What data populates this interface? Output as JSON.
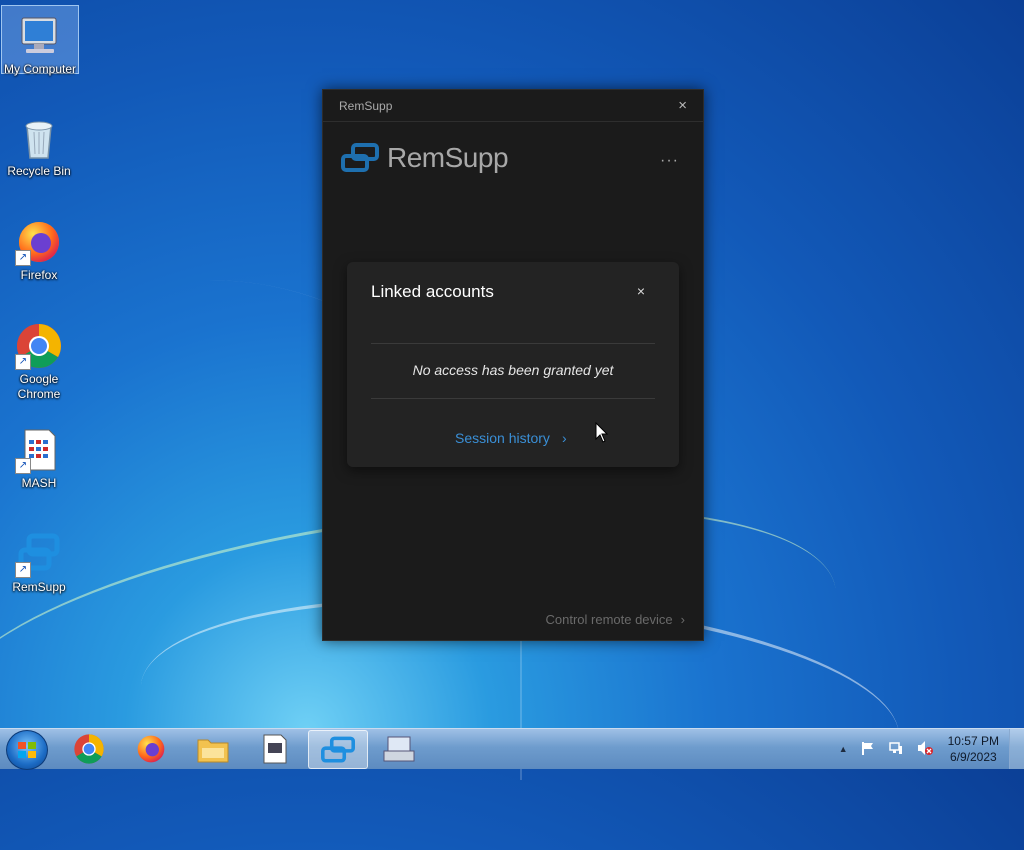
{
  "desktop": {
    "icons": [
      {
        "label": "My Computer"
      },
      {
        "label": "Recycle Bin"
      },
      {
        "label": "Firefox"
      },
      {
        "label": "Google Chrome"
      },
      {
        "label": "MASH"
      },
      {
        "label": "RemSupp"
      }
    ]
  },
  "window": {
    "title": "RemSupp",
    "brand": "RemSupp",
    "more_label": "···",
    "close_label": "×",
    "linked_accounts": {
      "title": "Linked accounts",
      "close_label": "×",
      "empty_message": "No access has been granted yet",
      "session_history": "Session history"
    },
    "control_remote": "Control remote device",
    "chevron": "›"
  },
  "taskbar": {
    "pinned": [
      "Google Chrome",
      "Firefox",
      "Windows Explorer",
      "MASH",
      "RemSupp",
      "On-Screen Keyboard"
    ],
    "clock_time": "10:57 PM",
    "clock_date": "6/9/2023",
    "tray_expand": "▲"
  },
  "colors": {
    "accent": "#3a8fd6",
    "window_bg": "#1b1b1b",
    "panel_bg": "#232323"
  }
}
